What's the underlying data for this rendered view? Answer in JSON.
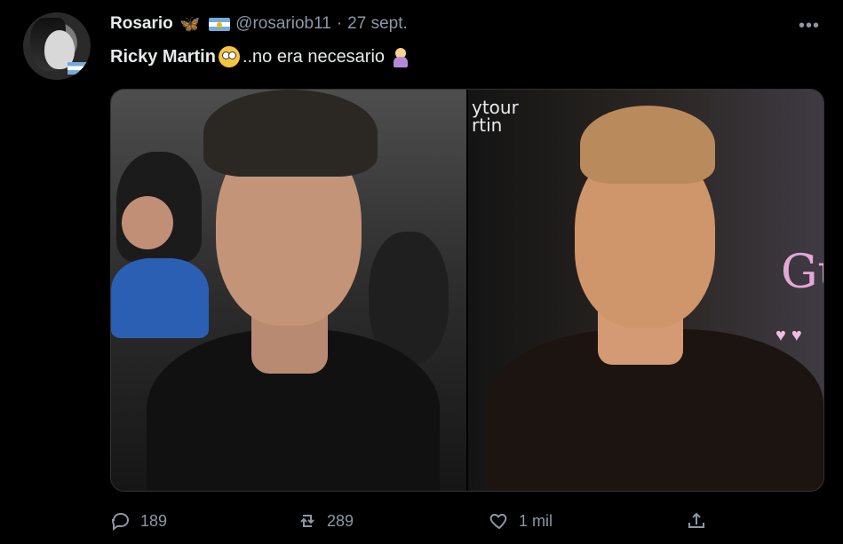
{
  "tweet": {
    "author": {
      "display_name": "Rosario",
      "handle": "@rosariob11",
      "date_separator": "·",
      "date": "27 sept."
    },
    "text": {
      "bold_part": "Ricky Martin",
      "rest": "..no era necesario"
    },
    "media": {
      "right_overlay_line1": "ytour",
      "right_overlay_line2": "rtin",
      "right_script": "Gu"
    },
    "actions": {
      "replies": "189",
      "retweets": "289",
      "likes": "1 mil"
    }
  },
  "icons": {
    "more": "more-dots-icon",
    "reply": "reply-icon",
    "retweet": "retweet-icon",
    "like": "heart-icon",
    "share": "share-icon",
    "butterfly": "butterfly-emoji-icon",
    "flag": "argentina-flag-icon",
    "flushed": "flushed-face-emoji-icon",
    "facepalm": "woman-facepalming-emoji-icon"
  },
  "colors": {
    "background": "#000000",
    "text": "#e7e9ea",
    "muted": "#8b98a5",
    "accent": "#1d9bf0"
  }
}
